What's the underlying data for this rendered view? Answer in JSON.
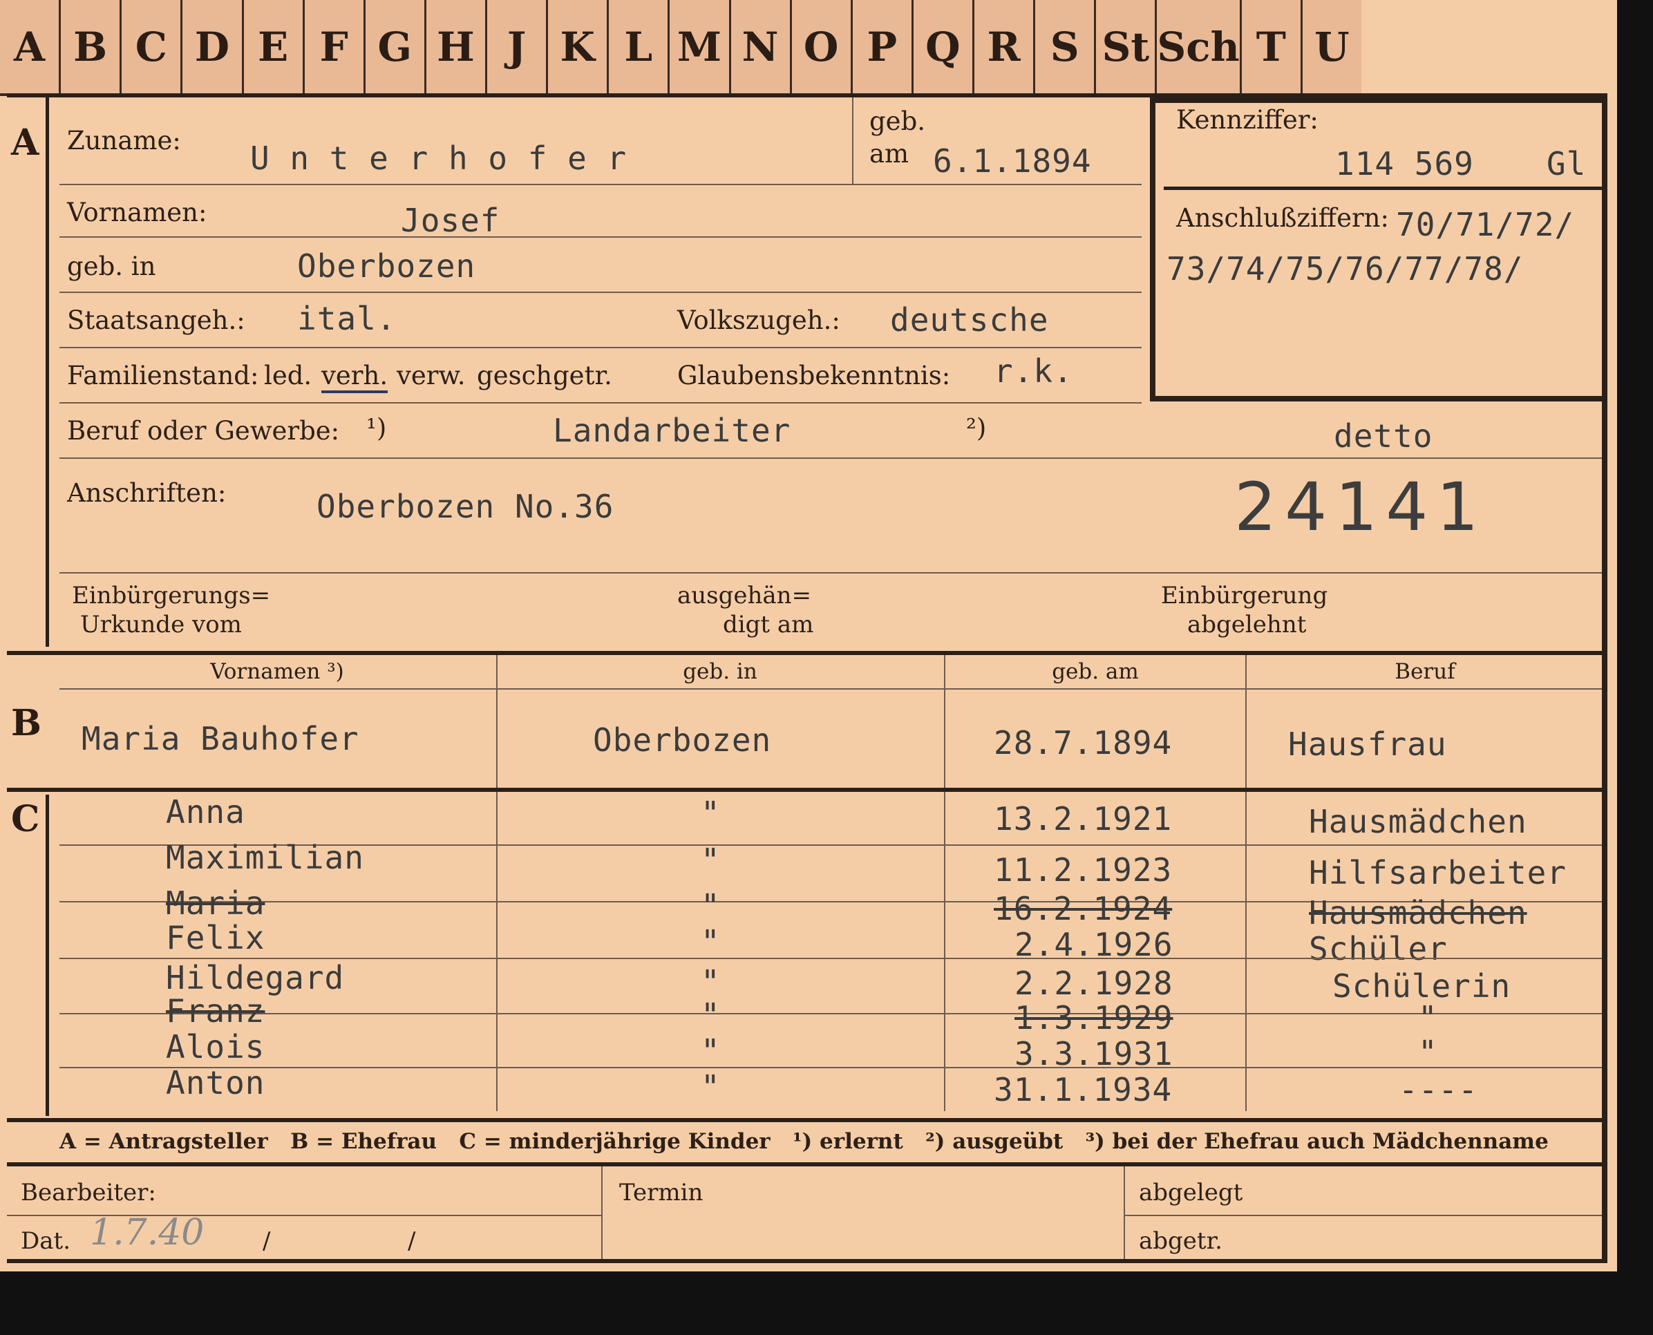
{
  "tabs": [
    "A",
    "B",
    "C",
    "D",
    "E",
    "F",
    "G",
    "H",
    "J",
    "K",
    "L",
    "M",
    "N",
    "O",
    "P",
    "Q",
    "R",
    "S",
    "St",
    "Sch",
    "T",
    "U"
  ],
  "sections": {
    "a": "A",
    "b": "B",
    "c": "C"
  },
  "applicant": {
    "surname_label": "Zuname:",
    "surname": "U n t e r h o f e r",
    "born_on_label1": "geb.",
    "born_on_label2": "am",
    "born_on": "6.1.1894",
    "given_names_label": "Vornamen:",
    "given_names": "Josef",
    "born_in_label": "geb. in",
    "born_in": "Oberbozen",
    "citizenship_label": "Staatsangeh.:",
    "citizenship": "ital.",
    "ethnicity_label": "Volkszugeh.:",
    "ethnicity": "deutsche",
    "marital_label": "Familienstand:",
    "marital_options": [
      "led.",
      "verh.",
      "verw.",
      "gesch.",
      "getr."
    ],
    "religion_label": "Glaubensbekenntnis:",
    "religion": "r.k.",
    "occupation_label": "Beruf oder Gewerbe:",
    "fn1": "¹)",
    "occupation_learned": "Landarbeiter",
    "fn2": "²)",
    "occupation_practiced": "detto",
    "address_label": "Anschriften:",
    "address": "Oberbozen No.36",
    "stamp_number": "24141",
    "naturalization_doc_label1": "Einbürgerungs=",
    "naturalization_doc_label2": "Urkunde vom",
    "handed_label1": "ausgehän=",
    "handed_label2": "digt am",
    "refused_label1": "Einbürgerung",
    "refused_label2": "abgelehnt"
  },
  "ref_box": {
    "label": "Kennziffer:",
    "number": "114 569",
    "suffix": "Gl",
    "related_label": "Anschlußziffern:",
    "related_line1": "70/71/72/",
    "related_line2": "73/74/75/76/77/78/"
  },
  "columns": [
    "Vornamen ³)",
    "geb. in",
    "geb. am",
    "Beruf"
  ],
  "wife": {
    "name": "Maria Bauhofer",
    "born_in": "Oberbozen",
    "born_on": "28.7.1894",
    "occupation": "Hausfrau"
  },
  "children": [
    {
      "name": "Anna",
      "born_in": "\"",
      "born_on": "13.2.1921",
      "occupation": "Hausmädchen",
      "struck": false
    },
    {
      "name": "Maximilian",
      "born_in": "\"",
      "born_on": "11.2.1923",
      "occupation": "Hilfsarbeiter",
      "struck": false
    },
    {
      "name": "Maria",
      "born_in": "\"",
      "born_on": "16.2.1924",
      "occupation": "Hausmädchen",
      "struck": true
    },
    {
      "name": "Felix",
      "born_in": "\"",
      "born_on": "2.4.1926",
      "occupation": "Schüler",
      "struck": false
    },
    {
      "name": "Hildegard",
      "born_in": "\"",
      "born_on": "2.2.1928",
      "occupation": "Schülerin",
      "struck": false
    },
    {
      "name": "Franz",
      "born_in": "\"",
      "born_on": "1.3.1929",
      "occupation": "\"",
      "struck": true
    },
    {
      "name": "Alois",
      "born_in": "\"",
      "born_on": "3.3.1931",
      "occupation": "\"",
      "struck": false
    },
    {
      "name": "Anton",
      "born_in": "\"",
      "born_on": "31.1.1934",
      "occupation": "----",
      "struck": false
    }
  ],
  "legend": "A = Antragsteller   B = Ehefrau   C = minderjährige Kinder   ¹) erlernt   ²) ausgeübt   ³) bei der Ehefrau auch Mädchenname",
  "footer": {
    "processor_label": "Bearbeiter:",
    "date_label": "Dat.",
    "date_value": "1.7.40",
    "slash1": "/",
    "slash2": "/",
    "deadline_label": "Termin",
    "filed_label": "abgelegt",
    "separated_label": "abgetr."
  }
}
